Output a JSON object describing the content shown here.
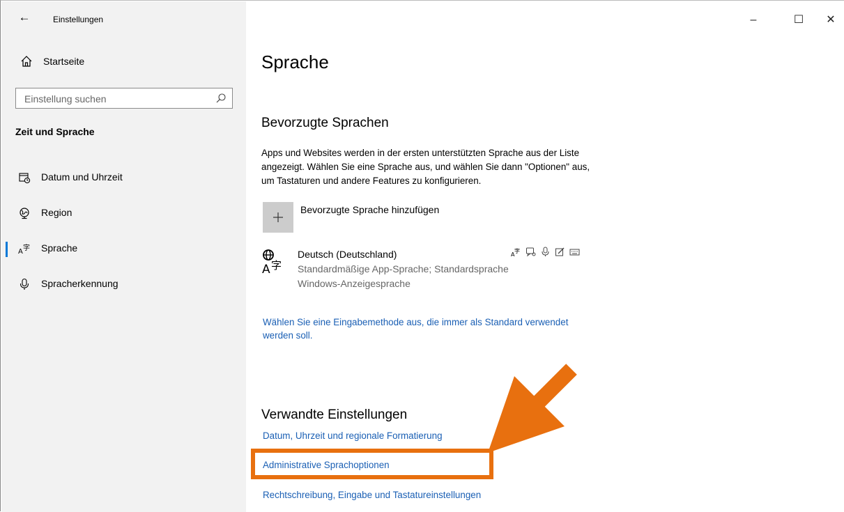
{
  "window": {
    "title": "Einstellungen",
    "controls": {
      "minimize": "–",
      "maximize": "☐",
      "close": "✕"
    }
  },
  "sidebar": {
    "home_label": "Startseite",
    "search_placeholder": "Einstellung suchen",
    "section_title": "Zeit und Sprache",
    "items": [
      {
        "label": "Datum und Uhrzeit",
        "icon": "calendar-clock-icon",
        "active": false
      },
      {
        "label": "Region",
        "icon": "globe-icon",
        "active": false
      },
      {
        "label": "Sprache",
        "icon": "language-icon",
        "active": true
      },
      {
        "label": "Spracherkennung",
        "icon": "microphone-icon",
        "active": false
      }
    ],
    "accent_color": "#0078d7"
  },
  "main": {
    "title": "Sprache",
    "preferred_heading": "Bevorzugte Sprachen",
    "preferred_description": "Apps und Websites werden in der ersten unterstützten Sprache aus der Liste angezeigt. Wählen Sie eine Sprache aus, und wählen Sie dann \"Optionen\" aus, um Tastaturen und andere Features zu konfigurieren.",
    "add_language_label": "Bevorzugte Sprache hinzufügen",
    "language": {
      "name": "Deutsch (Deutschland)",
      "line1": "Standardmäßige App-Sprache; Standardsprache",
      "line2": "Windows-Anzeigesprache",
      "feature_icons": [
        "language-pack-icon",
        "speech-icon",
        "microphone-icon",
        "handwriting-icon",
        "keyboard-icon"
      ]
    },
    "input_method_link": "Wählen Sie eine Eingabemethode aus, die immer als Standard verwendet werden soll.",
    "related_heading": "Verwandte Einstellungen",
    "related_links": [
      "Datum, Uhrzeit und regionale Formatierung",
      "Administrative Sprachoptionen",
      "Rechtschreibung, Eingabe und Tastatureinstellungen"
    ],
    "link_color": "#0063b1"
  },
  "annotation": {
    "color": "#e8700f",
    "highlighted_link": "Administrative Sprachoptionen"
  }
}
